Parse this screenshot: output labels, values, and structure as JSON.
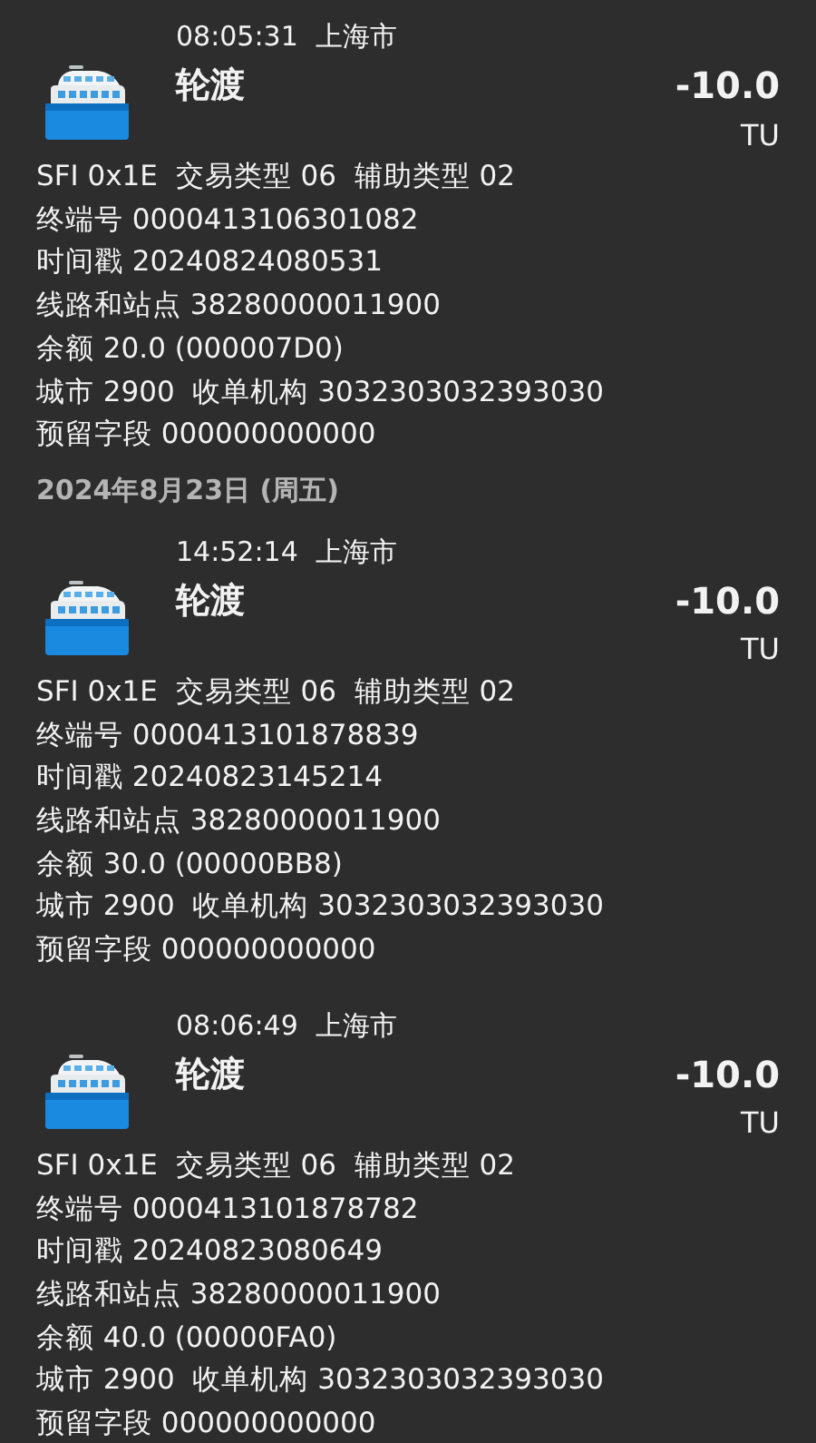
{
  "items": [
    {
      "kind": "transaction",
      "time": "08:05:31",
      "city": "上海市",
      "title": "轮渡",
      "amount": "-10.0",
      "unit": "TU",
      "details": [
        "SFI 0x1E  交易类型 06  辅助类型 02",
        "终端号 0000413106301082",
        "时间戳 20240824080531",
        "线路和站点 38280000011900",
        "余额 20.0 (000007D0)",
        "城市 2900  收单机构 3032303032393030",
        "预留字段 000000000000"
      ]
    },
    {
      "kind": "date_header",
      "text": "2024年8月23日 (周五)"
    },
    {
      "kind": "transaction",
      "time": "14:52:14",
      "city": "上海市",
      "title": "轮渡",
      "amount": "-10.0",
      "unit": "TU",
      "details": [
        "SFI 0x1E  交易类型 06  辅助类型 02",
        "终端号 0000413101878839",
        "时间戳 20240823145214",
        "线路和站点 38280000011900",
        "余额 30.0 (00000BB8)",
        "城市 2900  收单机构 3032303032393030",
        "预留字段 000000000000"
      ]
    },
    {
      "kind": "transaction",
      "time": "08:06:49",
      "city": "上海市",
      "title": "轮渡",
      "amount": "-10.0",
      "unit": "TU",
      "details": [
        "SFI 0x1E  交易类型 06  辅助类型 02",
        "终端号 0000413101878782",
        "时间戳 20240823080649",
        "线路和站点 38280000011900",
        "余额 40.0 (00000FA0)",
        "城市 2900  收单机构 3032303032393030",
        "预留字段 000000000000"
      ]
    }
  ]
}
